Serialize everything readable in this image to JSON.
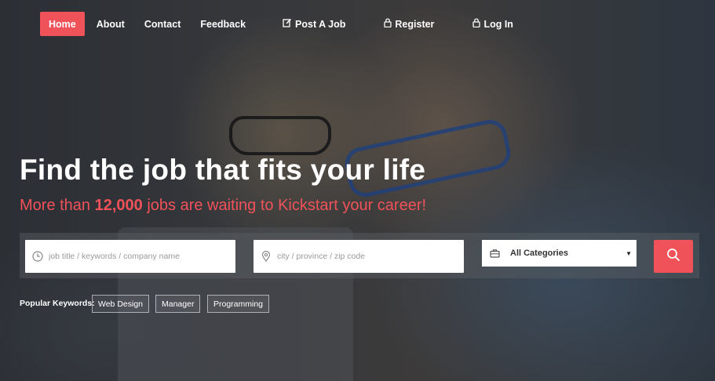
{
  "nav": {
    "items": [
      {
        "label": "Home",
        "active": true
      },
      {
        "label": "About"
      },
      {
        "label": "Contact"
      },
      {
        "label": "Feedback"
      },
      {
        "label": "Post A Job",
        "icon": "edit-icon"
      },
      {
        "label": "Register",
        "icon": "lock-icon"
      },
      {
        "label": "Log In",
        "icon": "lock-icon"
      }
    ]
  },
  "hero": {
    "headline": "Find the job that fits your life",
    "sub_prefix": "More than ",
    "sub_count": "12,000",
    "sub_suffix": " jobs are waiting to Kickstart your career!"
  },
  "search": {
    "keyword_placeholder": "job title / keywords / company name",
    "keyword_icon": "clock-icon",
    "location_placeholder": "city / province / zip code",
    "location_icon": "map-pin-icon",
    "category_value": "All Categories",
    "category_icon": "briefcase-icon",
    "button_icon": "search-icon"
  },
  "keywords": {
    "label": "Popular Keywords:",
    "items": [
      "Web Design",
      "Manager",
      "Programming"
    ]
  },
  "colors": {
    "accent": "#f0525a",
    "text_light": "#ffffff"
  }
}
